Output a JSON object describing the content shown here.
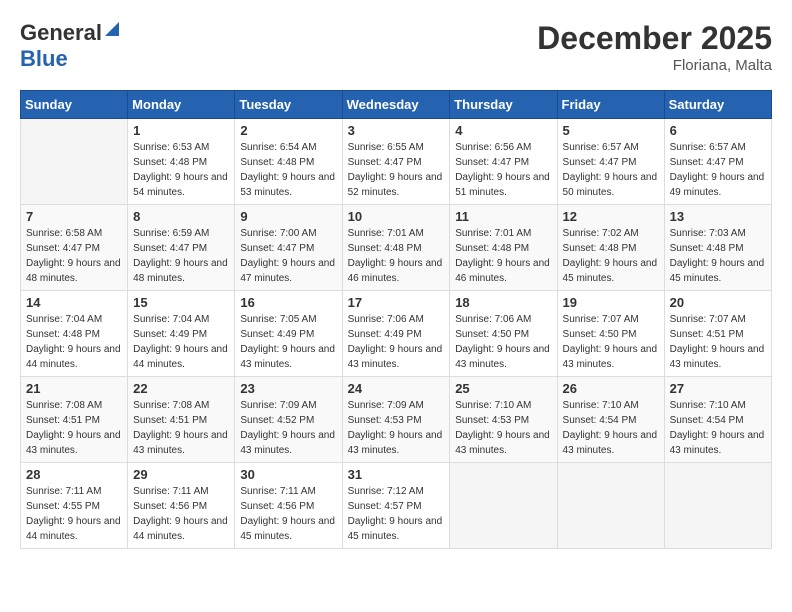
{
  "logo": {
    "general": "General",
    "blue": "Blue"
  },
  "title": "December 2025",
  "location": "Floriana, Malta",
  "days_header": [
    "Sunday",
    "Monday",
    "Tuesday",
    "Wednesday",
    "Thursday",
    "Friday",
    "Saturday"
  ],
  "weeks": [
    [
      {
        "day": "",
        "sunrise": "",
        "sunset": "",
        "daylight": ""
      },
      {
        "day": "1",
        "sunrise": "6:53 AM",
        "sunset": "4:48 PM",
        "daylight": "9 hours and 54 minutes."
      },
      {
        "day": "2",
        "sunrise": "6:54 AM",
        "sunset": "4:48 PM",
        "daylight": "9 hours and 53 minutes."
      },
      {
        "day": "3",
        "sunrise": "6:55 AM",
        "sunset": "4:47 PM",
        "daylight": "9 hours and 52 minutes."
      },
      {
        "day": "4",
        "sunrise": "6:56 AM",
        "sunset": "4:47 PM",
        "daylight": "9 hours and 51 minutes."
      },
      {
        "day": "5",
        "sunrise": "6:57 AM",
        "sunset": "4:47 PM",
        "daylight": "9 hours and 50 minutes."
      },
      {
        "day": "6",
        "sunrise": "6:57 AM",
        "sunset": "4:47 PM",
        "daylight": "9 hours and 49 minutes."
      }
    ],
    [
      {
        "day": "7",
        "sunrise": "6:58 AM",
        "sunset": "4:47 PM",
        "daylight": "9 hours and 48 minutes."
      },
      {
        "day": "8",
        "sunrise": "6:59 AM",
        "sunset": "4:47 PM",
        "daylight": "9 hours and 48 minutes."
      },
      {
        "day": "9",
        "sunrise": "7:00 AM",
        "sunset": "4:47 PM",
        "daylight": "9 hours and 47 minutes."
      },
      {
        "day": "10",
        "sunrise": "7:01 AM",
        "sunset": "4:48 PM",
        "daylight": "9 hours and 46 minutes."
      },
      {
        "day": "11",
        "sunrise": "7:01 AM",
        "sunset": "4:48 PM",
        "daylight": "9 hours and 46 minutes."
      },
      {
        "day": "12",
        "sunrise": "7:02 AM",
        "sunset": "4:48 PM",
        "daylight": "9 hours and 45 minutes."
      },
      {
        "day": "13",
        "sunrise": "7:03 AM",
        "sunset": "4:48 PM",
        "daylight": "9 hours and 45 minutes."
      }
    ],
    [
      {
        "day": "14",
        "sunrise": "7:04 AM",
        "sunset": "4:48 PM",
        "daylight": "9 hours and 44 minutes."
      },
      {
        "day": "15",
        "sunrise": "7:04 AM",
        "sunset": "4:49 PM",
        "daylight": "9 hours and 44 minutes."
      },
      {
        "day": "16",
        "sunrise": "7:05 AM",
        "sunset": "4:49 PM",
        "daylight": "9 hours and 43 minutes."
      },
      {
        "day": "17",
        "sunrise": "7:06 AM",
        "sunset": "4:49 PM",
        "daylight": "9 hours and 43 minutes."
      },
      {
        "day": "18",
        "sunrise": "7:06 AM",
        "sunset": "4:50 PM",
        "daylight": "9 hours and 43 minutes."
      },
      {
        "day": "19",
        "sunrise": "7:07 AM",
        "sunset": "4:50 PM",
        "daylight": "9 hours and 43 minutes."
      },
      {
        "day": "20",
        "sunrise": "7:07 AM",
        "sunset": "4:51 PM",
        "daylight": "9 hours and 43 minutes."
      }
    ],
    [
      {
        "day": "21",
        "sunrise": "7:08 AM",
        "sunset": "4:51 PM",
        "daylight": "9 hours and 43 minutes."
      },
      {
        "day": "22",
        "sunrise": "7:08 AM",
        "sunset": "4:51 PM",
        "daylight": "9 hours and 43 minutes."
      },
      {
        "day": "23",
        "sunrise": "7:09 AM",
        "sunset": "4:52 PM",
        "daylight": "9 hours and 43 minutes."
      },
      {
        "day": "24",
        "sunrise": "7:09 AM",
        "sunset": "4:53 PM",
        "daylight": "9 hours and 43 minutes."
      },
      {
        "day": "25",
        "sunrise": "7:10 AM",
        "sunset": "4:53 PM",
        "daylight": "9 hours and 43 minutes."
      },
      {
        "day": "26",
        "sunrise": "7:10 AM",
        "sunset": "4:54 PM",
        "daylight": "9 hours and 43 minutes."
      },
      {
        "day": "27",
        "sunrise": "7:10 AM",
        "sunset": "4:54 PM",
        "daylight": "9 hours and 43 minutes."
      }
    ],
    [
      {
        "day": "28",
        "sunrise": "7:11 AM",
        "sunset": "4:55 PM",
        "daylight": "9 hours and 44 minutes."
      },
      {
        "day": "29",
        "sunrise": "7:11 AM",
        "sunset": "4:56 PM",
        "daylight": "9 hours and 44 minutes."
      },
      {
        "day": "30",
        "sunrise": "7:11 AM",
        "sunset": "4:56 PM",
        "daylight": "9 hours and 45 minutes."
      },
      {
        "day": "31",
        "sunrise": "7:12 AM",
        "sunset": "4:57 PM",
        "daylight": "9 hours and 45 minutes."
      },
      {
        "day": "",
        "sunrise": "",
        "sunset": "",
        "daylight": ""
      },
      {
        "day": "",
        "sunrise": "",
        "sunset": "",
        "daylight": ""
      },
      {
        "day": "",
        "sunrise": "",
        "sunset": "",
        "daylight": ""
      }
    ]
  ]
}
